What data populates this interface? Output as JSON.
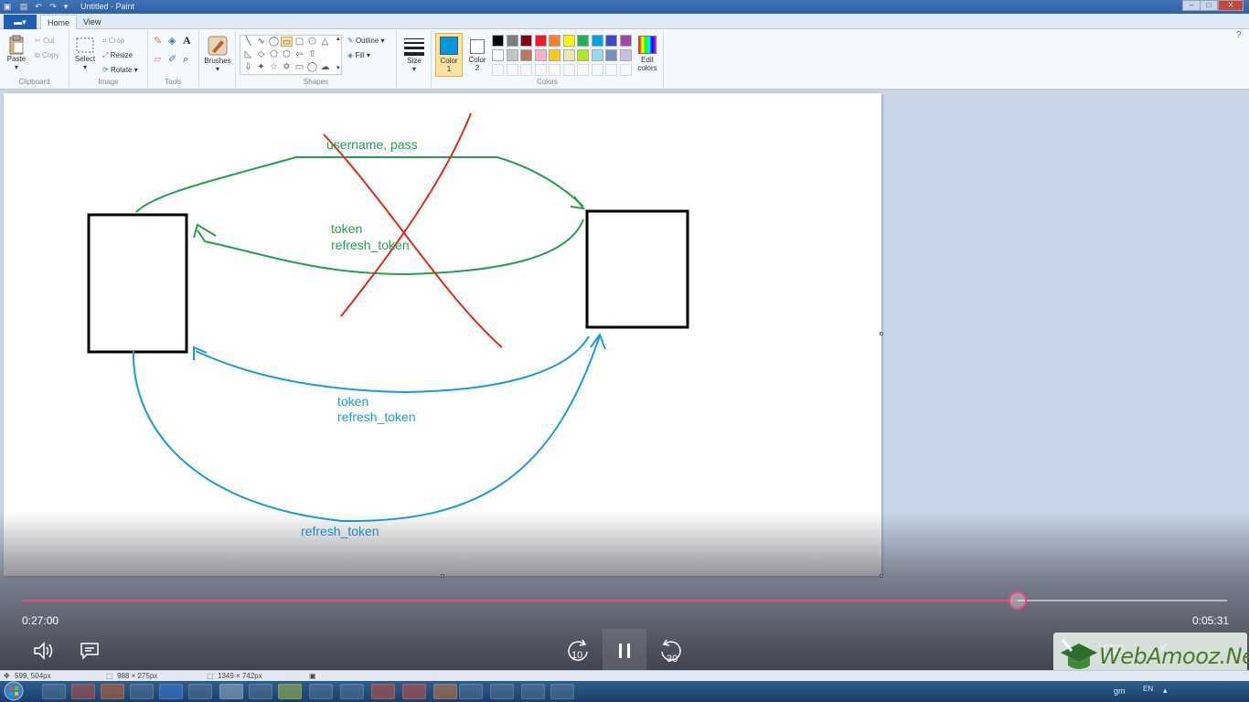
{
  "window": {
    "title": "Untitled - Paint",
    "controls": {
      "minimize": "–",
      "maximize": "□",
      "close": "✕"
    }
  },
  "tabs": [
    {
      "label": "Home",
      "active": true
    },
    {
      "label": "View",
      "active": false
    }
  ],
  "ribbon": {
    "clipboard": {
      "group": "Clipboard",
      "paste": "Paste",
      "cut": "Cut",
      "copy": "Copy"
    },
    "image": {
      "group": "Image",
      "select": "Select",
      "crop": "Crop",
      "resize": "Resize",
      "rotate": "Rotate"
    },
    "tools": {
      "group": "Tools"
    },
    "brushes": {
      "label": "Brushes"
    },
    "shapes": {
      "group": "Shapes",
      "outline": "Outline",
      "fill": "Fill"
    },
    "size": {
      "label": "Size"
    },
    "colors": {
      "group": "Colors",
      "color1_label": "Color",
      "color1_num": "1",
      "color2_label": "Color",
      "color2_num": "2",
      "edit_label": "Edit colors",
      "color1": "#0096e0",
      "color2": "#ffffff",
      "palette_row1": [
        "#000000",
        "#7f7f7f",
        "#880015",
        "#ed1c24",
        "#ff7f27",
        "#fff200",
        "#22b14c",
        "#00a2e8",
        "#3f48cc",
        "#a349a4"
      ],
      "palette_row2": [
        "#ffffff",
        "#c3c3c3",
        "#b97a57",
        "#ffaec9",
        "#ffc90e",
        "#efe4b0",
        "#b5e61d",
        "#99d9ea",
        "#7092be",
        "#c8bfe7"
      ]
    }
  },
  "drawing": {
    "top_label": "username, pass",
    "green_token": "token",
    "green_refresh": "refresh_token",
    "blue_token": "token",
    "blue_refresh": "refresh_token",
    "bottom_label": "refresh_token",
    "colors": {
      "green": "#22a04b",
      "red": "#e0291c",
      "blue": "#1a9be0",
      "black": "#000000"
    }
  },
  "player": {
    "elapsed": "0:27:00",
    "remaining": "0:05:31",
    "progress_fraction": 0.826,
    "skip_back": "10",
    "skip_forward": "30"
  },
  "statusbar": {
    "cursor": "599, 504px",
    "selection": "988 × 275px",
    "canvas_size": "1349 × 742px"
  },
  "watermark": {
    "text": "WebAmooz.Net"
  },
  "tray": {
    "user": "gm",
    "lang": "EN"
  }
}
